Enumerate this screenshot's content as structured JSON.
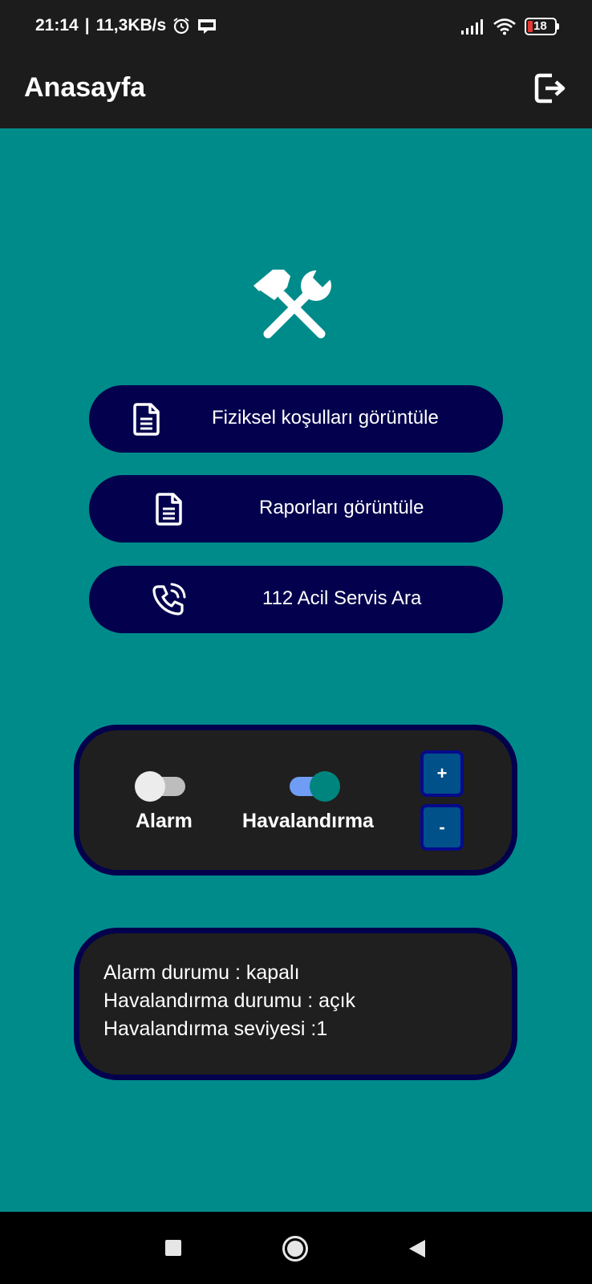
{
  "status_bar": {
    "time": "21:14",
    "network_speed": "11,3KB/s",
    "battery_level": "18",
    "icons": [
      "alarm-clock-icon",
      "webtoon-icon",
      "signal-icon",
      "wifi-icon",
      "battery-icon"
    ]
  },
  "app_bar": {
    "title": "Anasayfa",
    "action_icon": "logout-icon"
  },
  "header_icon": "hammer-wrench-icon",
  "menu": [
    {
      "label": "Fiziksel koşulları görüntüle",
      "icon": "document-icon"
    },
    {
      "label": "Raporları görüntüle",
      "icon": "document-icon"
    },
    {
      "label": "112 Acil Servis Ara",
      "icon": "phone-call-icon"
    }
  ],
  "controls": {
    "alarm": {
      "label": "Alarm",
      "on": false
    },
    "ventilation": {
      "label": "Havalandırma",
      "on": true
    },
    "plus_label": "+",
    "minus_label": "-"
  },
  "status": {
    "alarm_line": "Alarm durumu : kapalı",
    "ventilation_line": "Havalandırma durumu : açık",
    "level_line": "Havalandırma seviyesi :1"
  },
  "nav": {
    "icons": [
      "recents-icon",
      "home-icon",
      "back-icon"
    ]
  },
  "colors": {
    "background": "#008b8b",
    "bar": "#1c1c1c",
    "button": "#03014d",
    "panel": "#1f1f1f",
    "switch_on": "#00857e",
    "step_button": "#00508a"
  }
}
